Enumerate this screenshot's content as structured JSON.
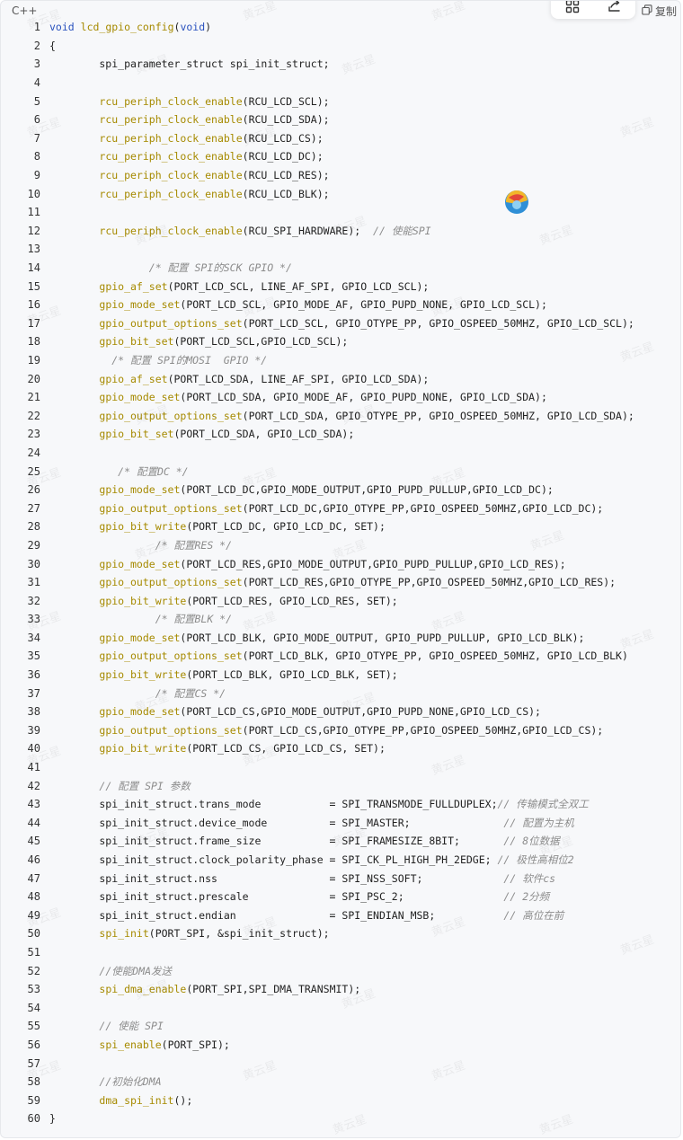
{
  "header": {
    "language": "C++",
    "copy_label": "复制"
  },
  "watermark": "黄云星",
  "code": [
    [
      {
        "t": "kw",
        "v": "void"
      },
      {
        "t": "tx",
        "v": " "
      },
      {
        "t": "fn",
        "v": "lcd_gpio_config"
      },
      {
        "t": "tx",
        "v": "("
      },
      {
        "t": "kw",
        "v": "void"
      },
      {
        "t": "tx",
        "v": ")"
      }
    ],
    [
      {
        "t": "tx",
        "v": "{"
      }
    ],
    [
      {
        "t": "tx",
        "v": "        spi_parameter_struct spi_init_struct;"
      }
    ],
    [],
    [
      {
        "t": "tx",
        "v": "        "
      },
      {
        "t": "fn",
        "v": "rcu_periph_clock_enable"
      },
      {
        "t": "tx",
        "v": "(RCU_LCD_SCL);"
      }
    ],
    [
      {
        "t": "tx",
        "v": "        "
      },
      {
        "t": "fn",
        "v": "rcu_periph_clock_enable"
      },
      {
        "t": "tx",
        "v": "(RCU_LCD_SDA);"
      }
    ],
    [
      {
        "t": "tx",
        "v": "        "
      },
      {
        "t": "fn",
        "v": "rcu_periph_clock_enable"
      },
      {
        "t": "tx",
        "v": "(RCU_LCD_CS);"
      }
    ],
    [
      {
        "t": "tx",
        "v": "        "
      },
      {
        "t": "fn",
        "v": "rcu_periph_clock_enable"
      },
      {
        "t": "tx",
        "v": "(RCU_LCD_DC);"
      }
    ],
    [
      {
        "t": "tx",
        "v": "        "
      },
      {
        "t": "fn",
        "v": "rcu_periph_clock_enable"
      },
      {
        "t": "tx",
        "v": "(RCU_LCD_RES);"
      }
    ],
    [
      {
        "t": "tx",
        "v": "        "
      },
      {
        "t": "fn",
        "v": "rcu_periph_clock_enable"
      },
      {
        "t": "tx",
        "v": "(RCU_LCD_BLK);"
      }
    ],
    [],
    [
      {
        "t": "tx",
        "v": "        "
      },
      {
        "t": "fn",
        "v": "rcu_periph_clock_enable"
      },
      {
        "t": "tx",
        "v": "(RCU_SPI_HARDWARE);  "
      },
      {
        "t": "cm",
        "v": "// 使能SPI"
      }
    ],
    [],
    [
      {
        "t": "tx",
        "v": "                "
      },
      {
        "t": "cm",
        "v": "/* 配置 SPI的SCK GPIO */"
      }
    ],
    [
      {
        "t": "tx",
        "v": "        "
      },
      {
        "t": "fn",
        "v": "gpio_af_set"
      },
      {
        "t": "tx",
        "v": "(PORT_LCD_SCL, LINE_AF_SPI, GPIO_LCD_SCL);"
      }
    ],
    [
      {
        "t": "tx",
        "v": "        "
      },
      {
        "t": "fn",
        "v": "gpio_mode_set"
      },
      {
        "t": "tx",
        "v": "(PORT_LCD_SCL, GPIO_MODE_AF, GPIO_PUPD_NONE, GPIO_LCD_SCL);"
      }
    ],
    [
      {
        "t": "tx",
        "v": "        "
      },
      {
        "t": "fn",
        "v": "gpio_output_options_set"
      },
      {
        "t": "tx",
        "v": "(PORT_LCD_SCL, GPIO_OTYPE_PP, GPIO_OSPEED_50MHZ, GPIO_LCD_SCL);"
      }
    ],
    [
      {
        "t": "tx",
        "v": "        "
      },
      {
        "t": "fn",
        "v": "gpio_bit_set"
      },
      {
        "t": "tx",
        "v": "(PORT_LCD_SCL,GPIO_LCD_SCL);"
      }
    ],
    [
      {
        "t": "tx",
        "v": "          "
      },
      {
        "t": "cm",
        "v": "/* 配置 SPI的MOSI  GPIO */"
      }
    ],
    [
      {
        "t": "tx",
        "v": "        "
      },
      {
        "t": "fn",
        "v": "gpio_af_set"
      },
      {
        "t": "tx",
        "v": "(PORT_LCD_SDA, LINE_AF_SPI, GPIO_LCD_SDA);"
      }
    ],
    [
      {
        "t": "tx",
        "v": "        "
      },
      {
        "t": "fn",
        "v": "gpio_mode_set"
      },
      {
        "t": "tx",
        "v": "(PORT_LCD_SDA, GPIO_MODE_AF, GPIO_PUPD_NONE, GPIO_LCD_SDA);"
      }
    ],
    [
      {
        "t": "tx",
        "v": "        "
      },
      {
        "t": "fn",
        "v": "gpio_output_options_set"
      },
      {
        "t": "tx",
        "v": "(PORT_LCD_SDA, GPIO_OTYPE_PP, GPIO_OSPEED_50MHZ, GPIO_LCD_SDA);"
      }
    ],
    [
      {
        "t": "tx",
        "v": "        "
      },
      {
        "t": "fn",
        "v": "gpio_bit_set"
      },
      {
        "t": "tx",
        "v": "(PORT_LCD_SDA, GPIO_LCD_SDA);"
      }
    ],
    [],
    [
      {
        "t": "tx",
        "v": "           "
      },
      {
        "t": "cm",
        "v": "/* 配置DC */"
      }
    ],
    [
      {
        "t": "tx",
        "v": "        "
      },
      {
        "t": "fn",
        "v": "gpio_mode_set"
      },
      {
        "t": "tx",
        "v": "(PORT_LCD_DC,GPIO_MODE_OUTPUT,GPIO_PUPD_PULLUP,GPIO_LCD_DC);"
      }
    ],
    [
      {
        "t": "tx",
        "v": "        "
      },
      {
        "t": "fn",
        "v": "gpio_output_options_set"
      },
      {
        "t": "tx",
        "v": "(PORT_LCD_DC,GPIO_OTYPE_PP,GPIO_OSPEED_50MHZ,GPIO_LCD_DC);"
      }
    ],
    [
      {
        "t": "tx",
        "v": "        "
      },
      {
        "t": "fn",
        "v": "gpio_bit_write"
      },
      {
        "t": "tx",
        "v": "(PORT_LCD_DC, GPIO_LCD_DC, SET);"
      }
    ],
    [
      {
        "t": "tx",
        "v": "                 "
      },
      {
        "t": "cm",
        "v": "/* 配置RES */"
      }
    ],
    [
      {
        "t": "tx",
        "v": "        "
      },
      {
        "t": "fn",
        "v": "gpio_mode_set"
      },
      {
        "t": "tx",
        "v": "(PORT_LCD_RES,GPIO_MODE_OUTPUT,GPIO_PUPD_PULLUP,GPIO_LCD_RES);"
      }
    ],
    [
      {
        "t": "tx",
        "v": "        "
      },
      {
        "t": "fn",
        "v": "gpio_output_options_set"
      },
      {
        "t": "tx",
        "v": "(PORT_LCD_RES,GPIO_OTYPE_PP,GPIO_OSPEED_50MHZ,GPIO_LCD_RES);"
      }
    ],
    [
      {
        "t": "tx",
        "v": "        "
      },
      {
        "t": "fn",
        "v": "gpio_bit_write"
      },
      {
        "t": "tx",
        "v": "(PORT_LCD_RES, GPIO_LCD_RES, SET);"
      }
    ],
    [
      {
        "t": "tx",
        "v": "                 "
      },
      {
        "t": "cm",
        "v": "/* 配置BLK */"
      }
    ],
    [
      {
        "t": "tx",
        "v": "        "
      },
      {
        "t": "fn",
        "v": "gpio_mode_set"
      },
      {
        "t": "tx",
        "v": "(PORT_LCD_BLK, GPIO_MODE_OUTPUT, GPIO_PUPD_PULLUP, GPIO_LCD_BLK);"
      }
    ],
    [
      {
        "t": "tx",
        "v": "        "
      },
      {
        "t": "fn",
        "v": "gpio_output_options_set"
      },
      {
        "t": "tx",
        "v": "(PORT_LCD_BLK, GPIO_OTYPE_PP, GPIO_OSPEED_50MHZ, GPIO_LCD_BLK)"
      }
    ],
    [
      {
        "t": "tx",
        "v": "        "
      },
      {
        "t": "fn",
        "v": "gpio_bit_write"
      },
      {
        "t": "tx",
        "v": "(PORT_LCD_BLK, GPIO_LCD_BLK, SET);"
      }
    ],
    [
      {
        "t": "tx",
        "v": "                 "
      },
      {
        "t": "cm",
        "v": "/* 配置CS */"
      }
    ],
    [
      {
        "t": "tx",
        "v": "        "
      },
      {
        "t": "fn",
        "v": "gpio_mode_set"
      },
      {
        "t": "tx",
        "v": "(PORT_LCD_CS,GPIO_MODE_OUTPUT,GPIO_PUPD_NONE,GPIO_LCD_CS);"
      }
    ],
    [
      {
        "t": "tx",
        "v": "        "
      },
      {
        "t": "fn",
        "v": "gpio_output_options_set"
      },
      {
        "t": "tx",
        "v": "(PORT_LCD_CS,GPIO_OTYPE_PP,GPIO_OSPEED_50MHZ,GPIO_LCD_CS);"
      }
    ],
    [
      {
        "t": "tx",
        "v": "        "
      },
      {
        "t": "fn",
        "v": "gpio_bit_write"
      },
      {
        "t": "tx",
        "v": "(PORT_LCD_CS, GPIO_LCD_CS, SET);"
      }
    ],
    [],
    [
      {
        "t": "tx",
        "v": "        "
      },
      {
        "t": "cm",
        "v": "// 配置 SPI 参数"
      }
    ],
    [
      {
        "t": "tx",
        "v": "        spi_init_struct.trans_mode           = SPI_TRANSMODE_FULLDUPLEX;"
      },
      {
        "t": "cm",
        "v": "// 传输模式全双工"
      }
    ],
    [
      {
        "t": "tx",
        "v": "        spi_init_struct.device_mode          = SPI_MASTER;               "
      },
      {
        "t": "cm",
        "v": "// 配置为主机"
      }
    ],
    [
      {
        "t": "tx",
        "v": "        spi_init_struct.frame_size           = SPI_FRAMESIZE_8BIT;       "
      },
      {
        "t": "cm",
        "v": "// 8位数据"
      }
    ],
    [
      {
        "t": "tx",
        "v": "        spi_init_struct.clock_polarity_phase = SPI_CK_PL_HIGH_PH_2EDGE; "
      },
      {
        "t": "cm",
        "v": "// 极性高相位2"
      }
    ],
    [
      {
        "t": "tx",
        "v": "        spi_init_struct.nss                  = SPI_NSS_SOFT;             "
      },
      {
        "t": "cm",
        "v": "// 软件cs"
      }
    ],
    [
      {
        "t": "tx",
        "v": "        spi_init_struct.prescale             = SPI_PSC_2;                "
      },
      {
        "t": "cm",
        "v": "// 2分频"
      }
    ],
    [
      {
        "t": "tx",
        "v": "        spi_init_struct.endian               = SPI_ENDIAN_MSB;           "
      },
      {
        "t": "cm",
        "v": "// 高位在前"
      }
    ],
    [
      {
        "t": "tx",
        "v": "        "
      },
      {
        "t": "fn",
        "v": "spi_init"
      },
      {
        "t": "tx",
        "v": "(PORT_SPI, &spi_init_struct);"
      }
    ],
    [],
    [
      {
        "t": "tx",
        "v": "        "
      },
      {
        "t": "cm",
        "v": "//使能DMA发送"
      }
    ],
    [
      {
        "t": "tx",
        "v": "        "
      },
      {
        "t": "fn",
        "v": "spi_dma_enable"
      },
      {
        "t": "tx",
        "v": "(PORT_SPI,SPI_DMA_TRANSMIT);"
      }
    ],
    [],
    [
      {
        "t": "tx",
        "v": "        "
      },
      {
        "t": "cm",
        "v": "// 使能 SPI"
      }
    ],
    [
      {
        "t": "tx",
        "v": "        "
      },
      {
        "t": "fn",
        "v": "spi_enable"
      },
      {
        "t": "tx",
        "v": "(PORT_SPI);"
      }
    ],
    [],
    [
      {
        "t": "tx",
        "v": "        "
      },
      {
        "t": "cm",
        "v": "//初始化DMA"
      }
    ],
    [
      {
        "t": "tx",
        "v": "        "
      },
      {
        "t": "fn",
        "v": "dma_spi_init"
      },
      {
        "t": "tx",
        "v": "();"
      }
    ],
    [
      {
        "t": "tx",
        "v": "}"
      }
    ]
  ]
}
